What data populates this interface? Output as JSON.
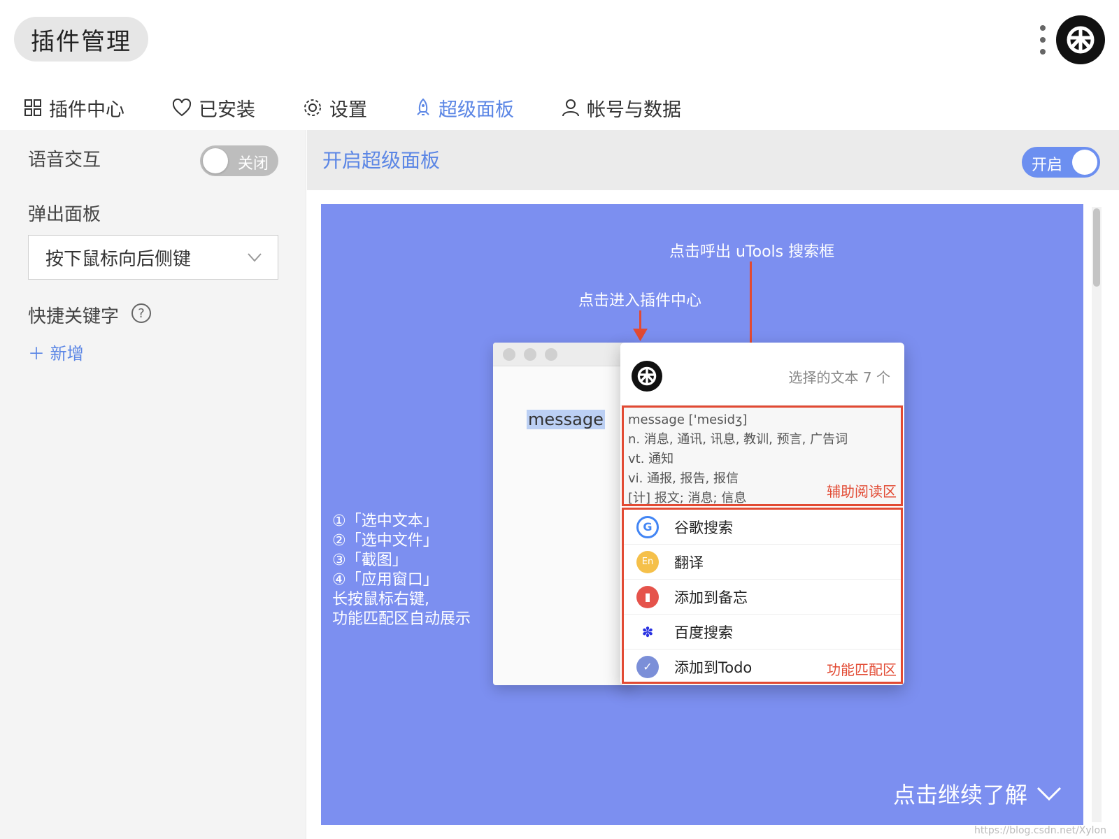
{
  "header": {
    "title": "插件管理",
    "more_icon": "more-vertical-icon",
    "logo_icon": "utools-logo-icon"
  },
  "tabs": [
    {
      "label": "插件中心",
      "icon": "grid-icon"
    },
    {
      "label": "已安装",
      "icon": "heart-icon"
    },
    {
      "label": "设置",
      "icon": "gear-icon"
    },
    {
      "label": "超级面板",
      "icon": "rocket-icon",
      "active": true
    },
    {
      "label": "帐号与数据",
      "icon": "user-icon"
    }
  ],
  "sidebar": {
    "voice_label": "语音交互",
    "voice_toggle": "关闭",
    "popup_label": "弹出面板",
    "popup_value": "按下鼠标向后侧键",
    "shortcut_label": "快捷关键字",
    "add_label": "新增"
  },
  "main": {
    "title": "开启超级面板",
    "toggle_label": "开启"
  },
  "preview": {
    "ann_search": "点击呼出 uTools 搜索框",
    "ann_center": "点击进入插件中心",
    "selected_word": "message",
    "selected_count": "选择的文本 7 个",
    "reading_lines": [
      "message ['mesidʒ]",
      "n. 消息, 通讯, 讯息, 教训, 预言, 广告词",
      "vt. 通知",
      "vi. 通报, 报告, 报信",
      "[计] 报文; 消息; 信息"
    ],
    "reading_tag": "辅助阅读区",
    "functions": [
      {
        "label": "谷歌搜索",
        "icon": "google-icon"
      },
      {
        "label": "翻译",
        "icon": "translate-icon"
      },
      {
        "label": "添加到备忘",
        "icon": "memo-icon"
      },
      {
        "label": "百度搜索",
        "icon": "baidu-icon"
      },
      {
        "label": "添加到Todo",
        "icon": "todo-check-icon"
      }
    ],
    "func_tag": "功能匹配区",
    "steps": [
      "①「选中文本」",
      "②「选中文件」",
      "③「截图」",
      "④「应用窗口」",
      "长按鼠标右键,",
      "功能匹配区自动展示"
    ],
    "continue_label": "点击继续了解"
  },
  "watermark": "https://blog.csdn.net/Xylon",
  "colors": {
    "accent": "#5b86e5",
    "preview_bg": "#7c8ff0",
    "highlight_red": "#e24a33"
  }
}
